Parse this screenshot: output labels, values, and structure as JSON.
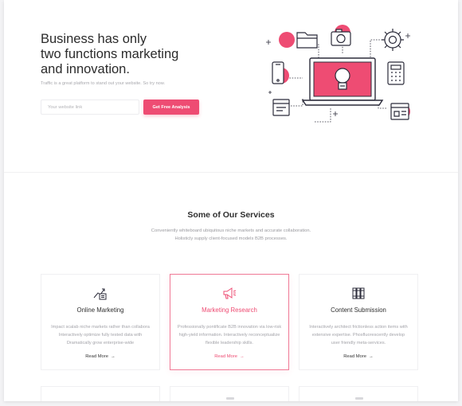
{
  "hero": {
    "title_line1": "Business has only",
    "title_line2": "two functions marketing",
    "title_line3": "and innovation.",
    "subtitle": "Traffic is a great platform to stand out your website. So try now.",
    "input_placeholder": "Your website link",
    "button_label": "Get Free Analysis"
  },
  "services": {
    "title": "Some of Our Services",
    "desc_line1": "Conveniently whiteboard ubiquitous niche markets and accurate collaboration.",
    "desc_line2": "Holisticly supply client-focused models B2B processes.",
    "cards": [
      {
        "title": "Online Marketing",
        "icon": "growth-chart-icon",
        "desc_line1": "Impact scalab niche markets rather than collabora",
        "desc_line2": "Interactively optimize fully tested data with",
        "desc_line3": "Dramatically grow enterprise-wide",
        "link": "Read More"
      },
      {
        "title": "Marketing Research",
        "icon": "megaphone-icon",
        "desc_line1": "Professionally pontificate B2B innovation via low-risk",
        "desc_line2": "high-yield information. Interactively reconceptualize",
        "desc_line3": "flexible leadership skills.",
        "link": "Read More"
      },
      {
        "title": "Content Submission",
        "icon": "binders-icon",
        "desc_line1": "Interactively architect frictionless action items with",
        "desc_line2": "extensive expertise. Phosfluorescently develop",
        "desc_line3": "user friendly meta-services.",
        "link": "Read More"
      }
    ]
  },
  "colors": {
    "accent": "#ee4c73",
    "text_dark": "#2b2b2b",
    "text_muted": "#a9a9ae"
  }
}
